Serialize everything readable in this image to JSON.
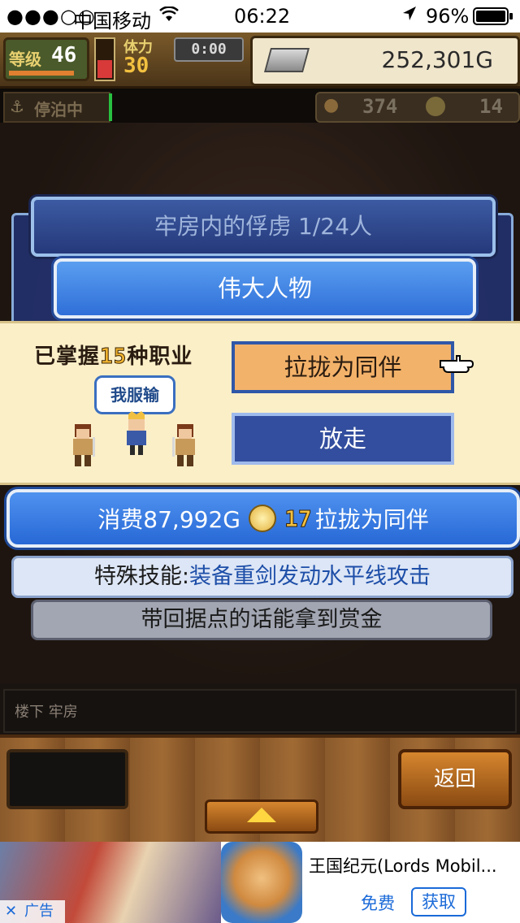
{
  "status_bar": {
    "signal": "●●●○○",
    "carrier": "中国移动",
    "time": "06:22",
    "battery": "96%"
  },
  "hud": {
    "level_label": "等级",
    "level": "46",
    "stamina_label": "体力",
    "stamina": "30",
    "timer": "0:00",
    "gold": "252,301G",
    "moored_label": "停泊中",
    "resource": "374",
    "medals": "14"
  },
  "dialog": {
    "title": "牢房内的俘虏  1/24人",
    "subtitle": "伟大人物"
  },
  "prisoner": {
    "jobs_prefix": "已掌握",
    "jobs_count": "15",
    "jobs_suffix": "种职业",
    "speech": "我服输"
  },
  "buttons": {
    "recruit": "拉拢为同伴",
    "release": "放走",
    "back": "返回"
  },
  "cost": {
    "prefix": "消费87,992G",
    "medals": "17",
    "action": "拉拢为同伴"
  },
  "skill": {
    "label": "特殊技能:",
    "value": "装备重剑发动水平线攻击"
  },
  "bounty": "带回据点的话能拿到赏金",
  "location": "楼下 牢房",
  "ad": {
    "title": "王国纪元(Lords Mobil...",
    "free": "免费",
    "get": "获取",
    "label": "广告"
  }
}
